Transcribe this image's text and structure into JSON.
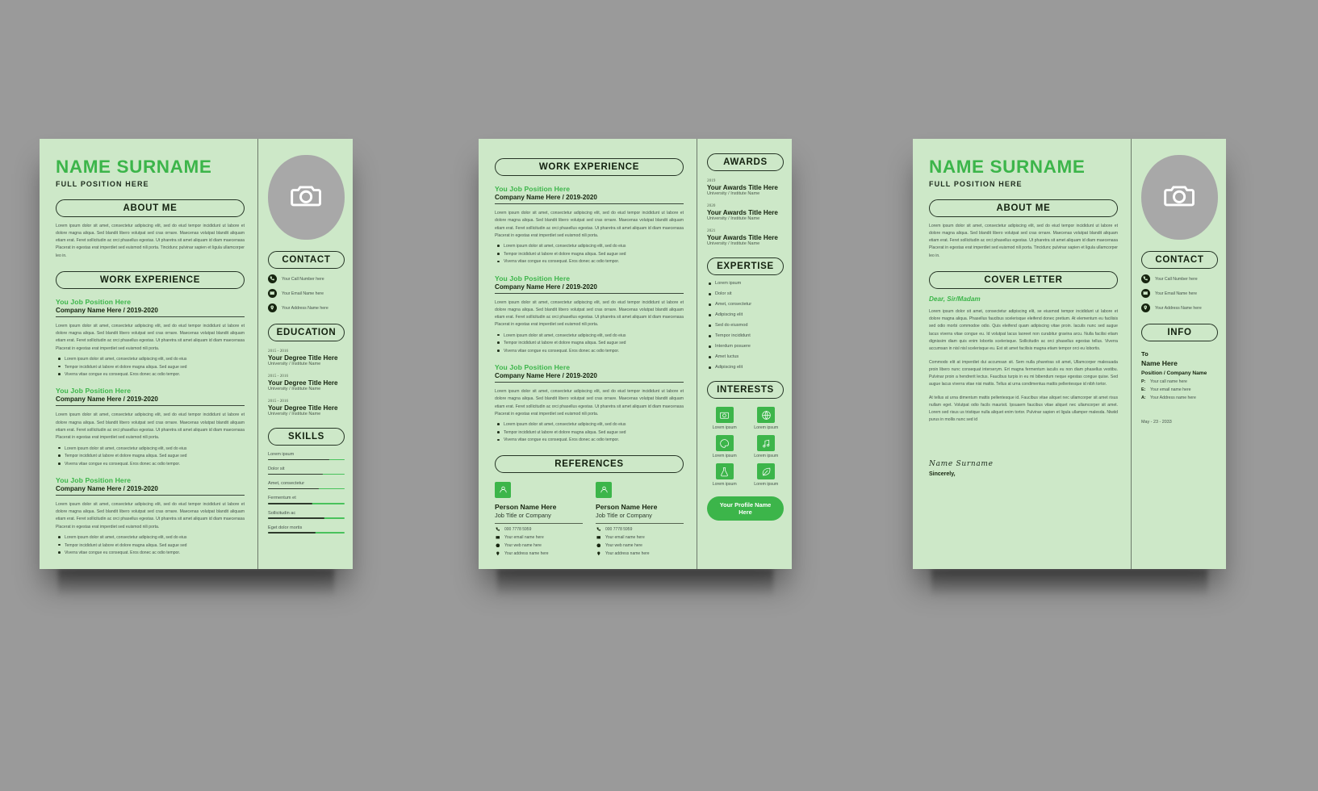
{
  "brand": {
    "green": "#3cb54a",
    "paper": "#cde8c8",
    "ink": "#16240f",
    "backdrop": "#9a9a9a"
  },
  "person": {
    "name": "NAME SURNAME",
    "position": "FULL POSITION HERE",
    "signature": "Name Surname",
    "sincerely": "Sincerely,"
  },
  "sections": {
    "about_me": "ABOUT ME",
    "work_experience": "WORK EXPERIENCE",
    "contact": "CONTACT",
    "education": "EDUCATION",
    "skills": "SKILLS",
    "awards": "AWARDS",
    "expertise": "EXPERTISE",
    "interests": "INTERESTS",
    "references": "REFERENCES",
    "cover_letter": "COVER LETTER",
    "info": "INFO"
  },
  "about_text": "Lorem ipsum dolor sit amet, consectetur adipiscing elit, sed do eiud tempor incididunt ut labore et dolore magna aliqua. Sed blandit libero volutpat sed cras ornare. Maecenas volutpat blandit aliquam etiam erat. Feret sollicitudin ac orci phasellus egestas. Ut pharetra sit amet aliquam id diam maecenasa Placerat in egestas erat imperdiet sed euismod nili porta. Tincidunc pulvinar sapien et ligula ullamcorper leo in.",
  "job": {
    "title": "You Job Position Here",
    "company": "Company Name Here / 2019-2020",
    "paragraph": "Lorem ipsum dolor sit amet, consectetur adipiscing elit, sed do eiud tempor incididunt ut labore et dolore magna aliqua. Sed blandit libero volutpat sed cras ornare. Maecenas volutpat blandit aliquam etiam erat. Feret sollicitudin ac orci phasellus egestas. Ut pharetra sit amet aliquam id diam maecenasa Placerat in egestas erat imperdiet sed euismod nili porta.",
    "bullets": [
      "Lorem ipsum dolor sit amet, consectetur adipiscing elit, sed do eius",
      "Tempor incididunt ut labore et dolore magna aliqua. Sed augue sed",
      "Viverra vitae congue eu consequat. Eros donec ac odio tempor."
    ]
  },
  "contact": {
    "items": [
      {
        "icon": "phone-icon",
        "text": "Your Call Number here"
      },
      {
        "icon": "email-icon",
        "text": "Your Email Name here"
      },
      {
        "icon": "location-icon",
        "text": "Your Address Name here"
      }
    ]
  },
  "education": [
    {
      "years": "2015 - 2016",
      "degree": "Your Degree Title Here",
      "school": "University / Institute Name"
    },
    {
      "years": "2015 - 2016",
      "degree": "Your Degree Title Here",
      "school": "University / Institute Name"
    },
    {
      "years": "2015 - 2016",
      "degree": "Your Degree Title Here",
      "school": "University / Institute Name"
    }
  ],
  "skills": [
    {
      "label": "Lorem ipsum",
      "percent": 80
    },
    {
      "label": "Dolor sit",
      "percent": 72
    },
    {
      "label": "Amet, consectetur",
      "percent": 66
    },
    {
      "label": "Fermentum et",
      "percent": 58
    },
    {
      "label": "Sollicitudin ac",
      "percent": 74
    },
    {
      "label": "Eget dolor mortis",
      "percent": 62
    }
  ],
  "awards": [
    {
      "year": "2019",
      "title": "Your Awards Title Here",
      "school": "University / Institute Name"
    },
    {
      "year": "2020",
      "title": "Your Awards Title Here",
      "school": "University / Institute Name"
    },
    {
      "year": "2021",
      "title": "Your Awards Title Here",
      "school": "University / Institute Name"
    }
  ],
  "expertise": [
    "Lorem ipsum",
    "Dolor sit",
    "Amet, consectetur",
    "Adipiscing elit",
    "Sed do eiusmod",
    "Tempor incididunt",
    "Interdum posuere",
    "Amet luctus",
    "Adipiscing elit"
  ],
  "interests": [
    {
      "icon": "camera-icon",
      "label": "Lorem ipsum"
    },
    {
      "icon": "globe-icon",
      "label": "Lorem ipsum"
    },
    {
      "icon": "palette-icon",
      "label": "Lorem ipsum"
    },
    {
      "icon": "music-icon",
      "label": "Lorem ipsum"
    },
    {
      "icon": "science-icon",
      "label": "Lorem ipsum"
    },
    {
      "icon": "leaf-icon",
      "label": "Lorem ipsum"
    }
  ],
  "profile_button": "Your Profile Name Here",
  "references": [
    {
      "name": "Person Name Here",
      "job": "Job Title or Company",
      "rows": [
        {
          "icon": "phone-icon",
          "text": "000 7778 5959"
        },
        {
          "icon": "email-icon",
          "text": "Your email name here"
        },
        {
          "icon": "web-icon",
          "text": "Your web name here"
        },
        {
          "icon": "location-icon",
          "text": "Your address name here"
        }
      ]
    },
    {
      "name": "Person Name Here",
      "job": "Job Title or Company",
      "rows": [
        {
          "icon": "phone-icon",
          "text": "000 7778 5959"
        },
        {
          "icon": "email-icon",
          "text": "Your email name here"
        },
        {
          "icon": "web-icon",
          "text": "Your web name here"
        },
        {
          "icon": "location-icon",
          "text": "Your address name here"
        }
      ]
    }
  ],
  "cover_letter": {
    "salutation": "Dear, Sir/Madam",
    "paragraph1": "Lorem ipsum dolor sit amet, consectetur adipiscing elit, se eiusmod tempor incididunt ut labore et dolore magna aliqua. Phasellus faucibus scelerisque eleifend donec pretium. At elementum eu facilisis sed odio morbi commodoe odio. Quis eleifend quam adipiscing vitae proin. Iaculis nunc sed augue lacus viverra vitae congue eu. Id volutpat lacus laoreet non curabitur gravina arcu. Nulla facilisi etiam dignissim diam quis enim lobortis scelerisque. Sollicitudin ac orci phasellus egestas tellus. Viverra accumsan in nisl nisl scelerisque eu. Est sit amet facilisis magna etiam tempor orci eu lobortis.",
    "paragraph2": "Commodo elit at imperdiet dui accumsan sit. Sem nulla pharetras sit amet, Ullamcorper malesuada proin libero nunc consequat interserym. Ert magna fermentum iaculis eu non diam phasellus vestibu. Pulvinar proin a hendrerit lectus. Faucibus turpis in eu mi bibendum neque egestas congue quise. Sed augue lacus viverra vitae nisi mattis. Tellus at urna condimentua mattis pellentesque id nibh tortor.",
    "paragraph3": "At tellus at urna dimentum mattis pellentesque id. Faucibus vitae aliquet nec ullamcorper sit amet risus nullam eget. Volutpat odio facils maurisit. Ipsuaem faucibus vitae aliquet nec ullamcorper sit amet. Lorem sed risus us tristique nulla aliquet enim tortor. Pulvinar sapien et ligula ullamper malesda. Niwiid purus in mollis nunc sed id"
  },
  "info": {
    "to": "To",
    "name": "Name Here",
    "position": "Position / Company Name",
    "rows": [
      {
        "key": "P:",
        "value": "Your call name here"
      },
      {
        "key": "E:",
        "value": "Your email name here"
      },
      {
        "key": "A:",
        "value": "Your Address name here"
      }
    ],
    "date": "May - 23 - 2033"
  }
}
